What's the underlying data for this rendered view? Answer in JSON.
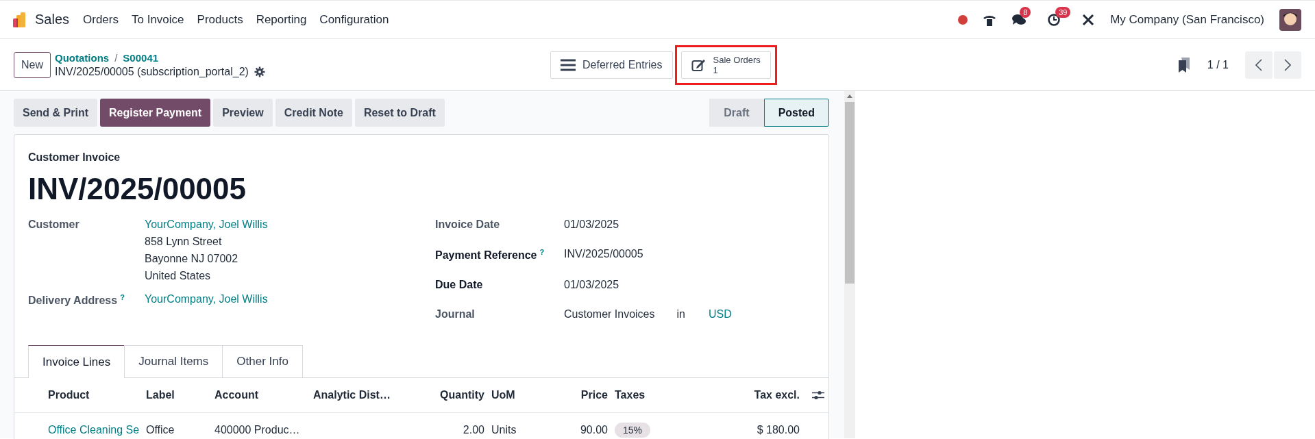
{
  "app": {
    "name": "Sales"
  },
  "menu": [
    "Orders",
    "To Invoice",
    "Products",
    "Reporting",
    "Configuration"
  ],
  "systray": {
    "messages_badge": "8",
    "activities_badge": "39",
    "company": "My Company (San Francisco)"
  },
  "control_panel": {
    "new_button": "New",
    "breadcrumbs": [
      "Quotations",
      "S00041"
    ],
    "breadcrumb_separator": "/",
    "record_name": "INV/2025/00005 (subscription_portal_2)",
    "pager": "1 / 1"
  },
  "smart_buttons": [
    {
      "kind": "list",
      "label": "Deferred Entries",
      "highlighted": false
    },
    {
      "kind": "edit",
      "label": "Sale Orders",
      "count": "1",
      "highlighted": true
    }
  ],
  "actions": [
    {
      "label": "Send & Print",
      "primary": false
    },
    {
      "label": "Register Payment",
      "primary": true
    },
    {
      "label": "Preview",
      "primary": false
    },
    {
      "label": "Credit Note",
      "primary": false
    },
    {
      "label": "Reset to Draft",
      "primary": false
    }
  ],
  "statusbar": [
    {
      "label": "Draft",
      "selected": false
    },
    {
      "label": "Posted",
      "selected": true
    }
  ],
  "invoice": {
    "type": "Customer Invoice",
    "number": "INV/2025/00005",
    "customer_label": "Customer",
    "customer": "YourCompany, Joel Willis",
    "address": [
      "858 Lynn Street",
      "Bayonne NJ 07002",
      "United States"
    ],
    "delivery_label": "Delivery Address",
    "delivery_help": "?",
    "delivery": "YourCompany, Joel Willis",
    "fields": [
      {
        "label": "Invoice Date",
        "value": "01/03/2025",
        "bold": false
      },
      {
        "label": "Payment Reference",
        "value": "INV/2025/00005",
        "bold": true,
        "help": "?"
      },
      {
        "label": "Due Date",
        "value": "01/03/2025",
        "bold": true
      },
      {
        "label": "Journal",
        "value": "Customer Invoices",
        "bold": false,
        "joiner": "in",
        "currency": "USD"
      }
    ]
  },
  "tabs": [
    {
      "label": "Invoice Lines",
      "selected": true
    },
    {
      "label": "Journal Items",
      "selected": false
    },
    {
      "label": "Other Info",
      "selected": false
    }
  ],
  "table": {
    "columns": [
      "Product",
      "Label",
      "Account",
      "Analytic Dist…",
      "Quantity",
      "UoM",
      "Price",
      "Taxes",
      "Tax excl."
    ],
    "rows": [
      {
        "product": "Office Cleaning Se",
        "label": "Office",
        "account": "400000 Produc…",
        "analytic": "",
        "quantity": "2.00",
        "uom": "Units",
        "price": "90.00",
        "taxes": "15%",
        "tax_excl": "$ 180.00"
      }
    ]
  }
}
